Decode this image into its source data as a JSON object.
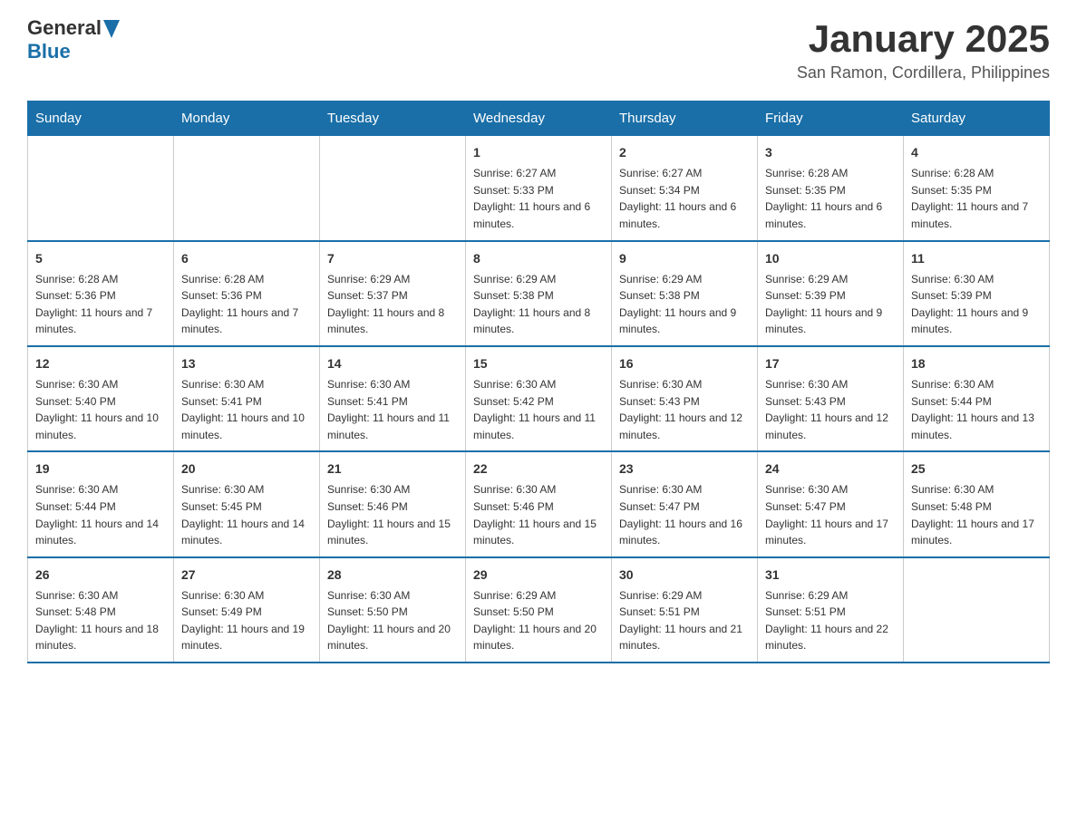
{
  "logo": {
    "text_general": "General",
    "text_blue": "Blue"
  },
  "title": "January 2025",
  "location": "San Ramon, Cordillera, Philippines",
  "days_of_week": [
    "Sunday",
    "Monday",
    "Tuesday",
    "Wednesday",
    "Thursday",
    "Friday",
    "Saturday"
  ],
  "weeks": [
    [
      {
        "day": "",
        "info": ""
      },
      {
        "day": "",
        "info": ""
      },
      {
        "day": "",
        "info": ""
      },
      {
        "day": "1",
        "info": "Sunrise: 6:27 AM\nSunset: 5:33 PM\nDaylight: 11 hours and 6 minutes."
      },
      {
        "day": "2",
        "info": "Sunrise: 6:27 AM\nSunset: 5:34 PM\nDaylight: 11 hours and 6 minutes."
      },
      {
        "day": "3",
        "info": "Sunrise: 6:28 AM\nSunset: 5:35 PM\nDaylight: 11 hours and 6 minutes."
      },
      {
        "day": "4",
        "info": "Sunrise: 6:28 AM\nSunset: 5:35 PM\nDaylight: 11 hours and 7 minutes."
      }
    ],
    [
      {
        "day": "5",
        "info": "Sunrise: 6:28 AM\nSunset: 5:36 PM\nDaylight: 11 hours and 7 minutes."
      },
      {
        "day": "6",
        "info": "Sunrise: 6:28 AM\nSunset: 5:36 PM\nDaylight: 11 hours and 7 minutes."
      },
      {
        "day": "7",
        "info": "Sunrise: 6:29 AM\nSunset: 5:37 PM\nDaylight: 11 hours and 8 minutes."
      },
      {
        "day": "8",
        "info": "Sunrise: 6:29 AM\nSunset: 5:38 PM\nDaylight: 11 hours and 8 minutes."
      },
      {
        "day": "9",
        "info": "Sunrise: 6:29 AM\nSunset: 5:38 PM\nDaylight: 11 hours and 9 minutes."
      },
      {
        "day": "10",
        "info": "Sunrise: 6:29 AM\nSunset: 5:39 PM\nDaylight: 11 hours and 9 minutes."
      },
      {
        "day": "11",
        "info": "Sunrise: 6:30 AM\nSunset: 5:39 PM\nDaylight: 11 hours and 9 minutes."
      }
    ],
    [
      {
        "day": "12",
        "info": "Sunrise: 6:30 AM\nSunset: 5:40 PM\nDaylight: 11 hours and 10 minutes."
      },
      {
        "day": "13",
        "info": "Sunrise: 6:30 AM\nSunset: 5:41 PM\nDaylight: 11 hours and 10 minutes."
      },
      {
        "day": "14",
        "info": "Sunrise: 6:30 AM\nSunset: 5:41 PM\nDaylight: 11 hours and 11 minutes."
      },
      {
        "day": "15",
        "info": "Sunrise: 6:30 AM\nSunset: 5:42 PM\nDaylight: 11 hours and 11 minutes."
      },
      {
        "day": "16",
        "info": "Sunrise: 6:30 AM\nSunset: 5:43 PM\nDaylight: 11 hours and 12 minutes."
      },
      {
        "day": "17",
        "info": "Sunrise: 6:30 AM\nSunset: 5:43 PM\nDaylight: 11 hours and 12 minutes."
      },
      {
        "day": "18",
        "info": "Sunrise: 6:30 AM\nSunset: 5:44 PM\nDaylight: 11 hours and 13 minutes."
      }
    ],
    [
      {
        "day": "19",
        "info": "Sunrise: 6:30 AM\nSunset: 5:44 PM\nDaylight: 11 hours and 14 minutes."
      },
      {
        "day": "20",
        "info": "Sunrise: 6:30 AM\nSunset: 5:45 PM\nDaylight: 11 hours and 14 minutes."
      },
      {
        "day": "21",
        "info": "Sunrise: 6:30 AM\nSunset: 5:46 PM\nDaylight: 11 hours and 15 minutes."
      },
      {
        "day": "22",
        "info": "Sunrise: 6:30 AM\nSunset: 5:46 PM\nDaylight: 11 hours and 15 minutes."
      },
      {
        "day": "23",
        "info": "Sunrise: 6:30 AM\nSunset: 5:47 PM\nDaylight: 11 hours and 16 minutes."
      },
      {
        "day": "24",
        "info": "Sunrise: 6:30 AM\nSunset: 5:47 PM\nDaylight: 11 hours and 17 minutes."
      },
      {
        "day": "25",
        "info": "Sunrise: 6:30 AM\nSunset: 5:48 PM\nDaylight: 11 hours and 17 minutes."
      }
    ],
    [
      {
        "day": "26",
        "info": "Sunrise: 6:30 AM\nSunset: 5:48 PM\nDaylight: 11 hours and 18 minutes."
      },
      {
        "day": "27",
        "info": "Sunrise: 6:30 AM\nSunset: 5:49 PM\nDaylight: 11 hours and 19 minutes."
      },
      {
        "day": "28",
        "info": "Sunrise: 6:30 AM\nSunset: 5:50 PM\nDaylight: 11 hours and 20 minutes."
      },
      {
        "day": "29",
        "info": "Sunrise: 6:29 AM\nSunset: 5:50 PM\nDaylight: 11 hours and 20 minutes."
      },
      {
        "day": "30",
        "info": "Sunrise: 6:29 AM\nSunset: 5:51 PM\nDaylight: 11 hours and 21 minutes."
      },
      {
        "day": "31",
        "info": "Sunrise: 6:29 AM\nSunset: 5:51 PM\nDaylight: 11 hours and 22 minutes."
      },
      {
        "day": "",
        "info": ""
      }
    ]
  ],
  "colors": {
    "header_bg": "#1a6fa8",
    "header_text": "#ffffff",
    "border": "#1a6fa8"
  }
}
